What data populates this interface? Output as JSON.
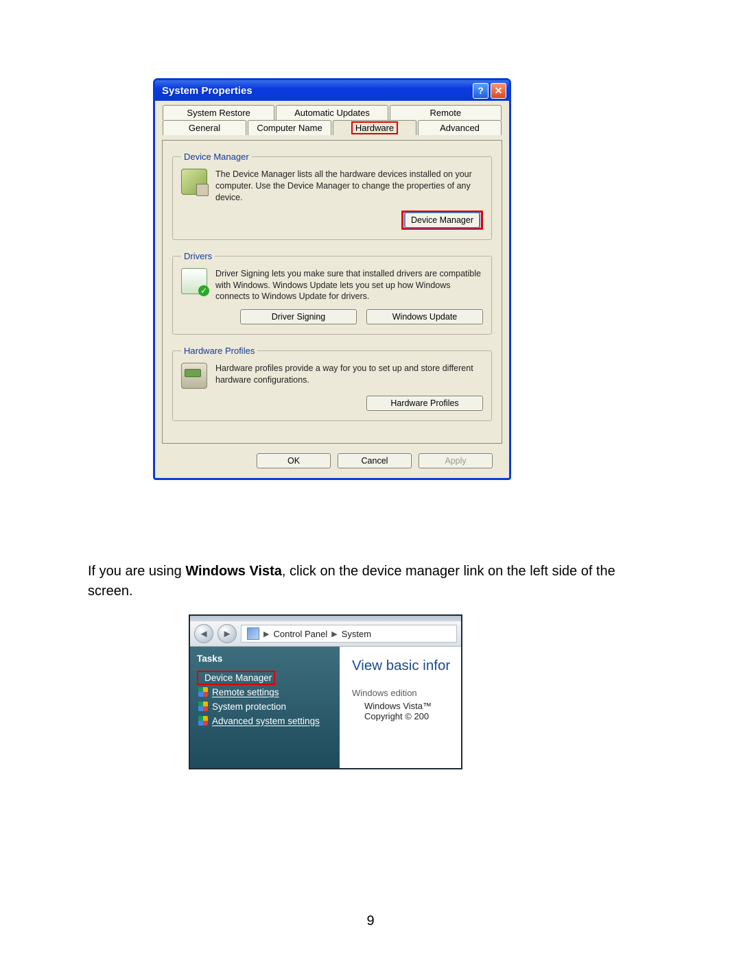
{
  "xp": {
    "title": "System Properties",
    "tabs_back": [
      "System Restore",
      "Automatic Updates",
      "Remote"
    ],
    "tabs_front": [
      "General",
      "Computer Name",
      "Hardware",
      "Advanced"
    ],
    "active_tab_index": 2,
    "groups": {
      "device_manager": {
        "legend": "Device Manager",
        "text": "The Device Manager lists all the hardware devices installed on your computer. Use the Device Manager to change the properties of any device.",
        "button": "Device Manager"
      },
      "drivers": {
        "legend": "Drivers",
        "text": "Driver Signing lets you make sure that installed drivers are compatible with Windows. Windows Update lets you set up how Windows connects to Windows Update for drivers.",
        "button1": "Driver Signing",
        "button2": "Windows Update"
      },
      "hardware_profiles": {
        "legend": "Hardware Profiles",
        "text": "Hardware profiles provide a way for you to set up and store different hardware configurations.",
        "button": "Hardware Profiles"
      }
    },
    "footer": {
      "ok": "OK",
      "cancel": "Cancel",
      "apply": "Apply"
    }
  },
  "doc": {
    "prefix": "If you are using ",
    "bold": "Windows Vista",
    "suffix": ", click on the device manager link on the left side of the screen."
  },
  "vista": {
    "breadcrumb": [
      "Control Panel",
      "System"
    ],
    "tasks_label": "Tasks",
    "links": [
      "Device Manager",
      "Remote settings",
      "System protection",
      "Advanced system settings"
    ],
    "highlight_index": 0,
    "heading": "View basic infor",
    "section_label": "Windows edition",
    "body_line1": "Windows Vista™",
    "body_line2": "Copyright © 200"
  },
  "page_number": "9"
}
